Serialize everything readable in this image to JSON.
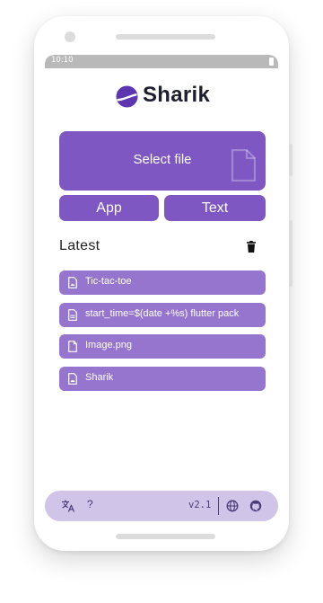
{
  "status_bar": {
    "time": "10:10"
  },
  "app": {
    "title": "Sharik",
    "accent_color": "#7e57c2",
    "item_color": "#9575cd",
    "bottom_bar_color": "#d1c4e9"
  },
  "actions": {
    "select_file_label": "Select file",
    "app_label": "App",
    "text_label": "Text"
  },
  "history": {
    "title": "Latest",
    "items": [
      {
        "label": "Tic-tac-toe",
        "icon": "app-icon"
      },
      {
        "label": "start_time=$(date +%s)  flutter pack",
        "icon": "text-icon"
      },
      {
        "label": "Image.png",
        "icon": "file-icon"
      },
      {
        "label": "Sharik",
        "icon": "app-icon"
      }
    ]
  },
  "bottom_bar": {
    "language_icon": "translate-icon",
    "help_label": "?",
    "version": "v2.1",
    "website_icon": "globe-icon",
    "github_icon": "github-icon"
  }
}
